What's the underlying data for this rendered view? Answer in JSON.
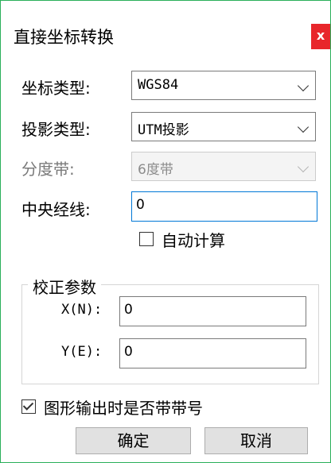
{
  "dialog": {
    "title": "直接坐标转换",
    "close_label": "x"
  },
  "form": {
    "coord_type_label": "坐标类型:",
    "coord_type_value": "WGS84",
    "projection_type_label": "投影类型:",
    "projection_type_value": "UTM投影",
    "zone_label": "分度带:",
    "zone_value": "6度带",
    "central_meridian_label": "中央经线:",
    "central_meridian_value": "0",
    "auto_calc_label": "自动计算",
    "auto_calc_checked": false
  },
  "correction": {
    "title": "校正参数",
    "x_label": "X(N):",
    "x_value": "0",
    "y_label": "Y(E):",
    "y_value": "0"
  },
  "output_zone": {
    "label": "图形输出时是否带带号",
    "checked": true
  },
  "buttons": {
    "ok_label": "确定",
    "cancel_label": "取消"
  }
}
